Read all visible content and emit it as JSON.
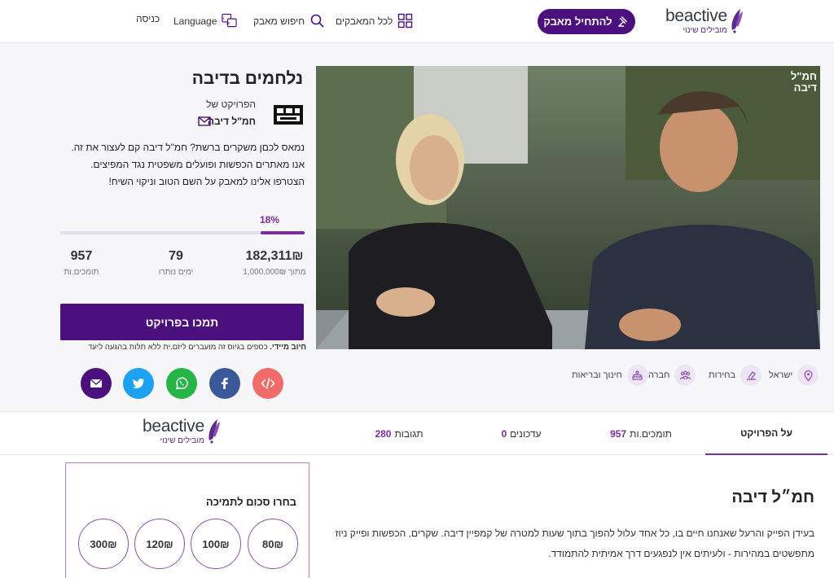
{
  "header": {
    "brand_word": "beactive",
    "brand_tagline": "מובילים שינוי",
    "cta_label": "להתחיל מאבק",
    "nav": {
      "all_campaigns": "לכל המאבקים",
      "search": "חיפוש מאבק",
      "language": "Language",
      "login": "כניסה"
    }
  },
  "project": {
    "title": "נלחמים בדיבה",
    "owner_label": "הפרויקט של",
    "owner_name": "חמ\"ל דיבה",
    "description": "נמאס לכםן משקרים ברשת? חמ\"ל דיבה קם לעצור את זה. אנו מאתרים הכפשות ופועלים משפטית נגד המפיצים. הצטרפו אלינו למאבק על השם הטוב וניקוי השיח!",
    "video_watermark": "חמ\"ל דיבה",
    "progress_percent_label": "18%",
    "progress_fraction": 0.18,
    "stats": {
      "raised": "182,311₪",
      "raised_label": "מתוך 1,000,000₪",
      "days": "79",
      "days_label": "ימים נותרו",
      "supporters": "957",
      "supporters_label": "תומכים.ות"
    },
    "support_button": "תמכו בפרויקט",
    "notice_bold": "חיוב מיידי.",
    "notice_text": " כספים בגיוס זה מועברים ליזם.ית ללא תלות בהגעה ליעד",
    "tags": [
      "ישראל",
      "בחירות",
      "חברה",
      "חינוך ובריאות"
    ]
  },
  "share": {
    "colors": {
      "embed": "#f26b6b",
      "facebook": "#3b5998",
      "whatsapp": "#25b546",
      "twitter": "#1da1f2",
      "email": "#4b0f7e"
    }
  },
  "tabs": {
    "about": "על הפרויקט",
    "supporters_label": "תומכים.ות",
    "supporters_count": "957",
    "updates_label": "עדכונים",
    "updates_count": "0",
    "comments_label": "תגובות",
    "comments_count": "280"
  },
  "content": {
    "section_title": "חמ״ל דיבה",
    "body": "בעידן הפייק והרעל שאנחנו חיים בו, כל אחד עלול להפוך בתוך שעות למטרה של קמפיין דיבה. שקרים, הכפשות ופייק ניוז מתפשטים במהירות - ולעיתים אין לנפגעים דרך אמיתית להתמודד."
  },
  "donate": {
    "title": "בחרו סכום לתמיכה",
    "amounts": [
      "80₪",
      "100₪",
      "120₪",
      "300₪"
    ]
  },
  "colors": {
    "brand_purple": "#4b0f7e",
    "accent_purple": "#7b2d9c"
  }
}
